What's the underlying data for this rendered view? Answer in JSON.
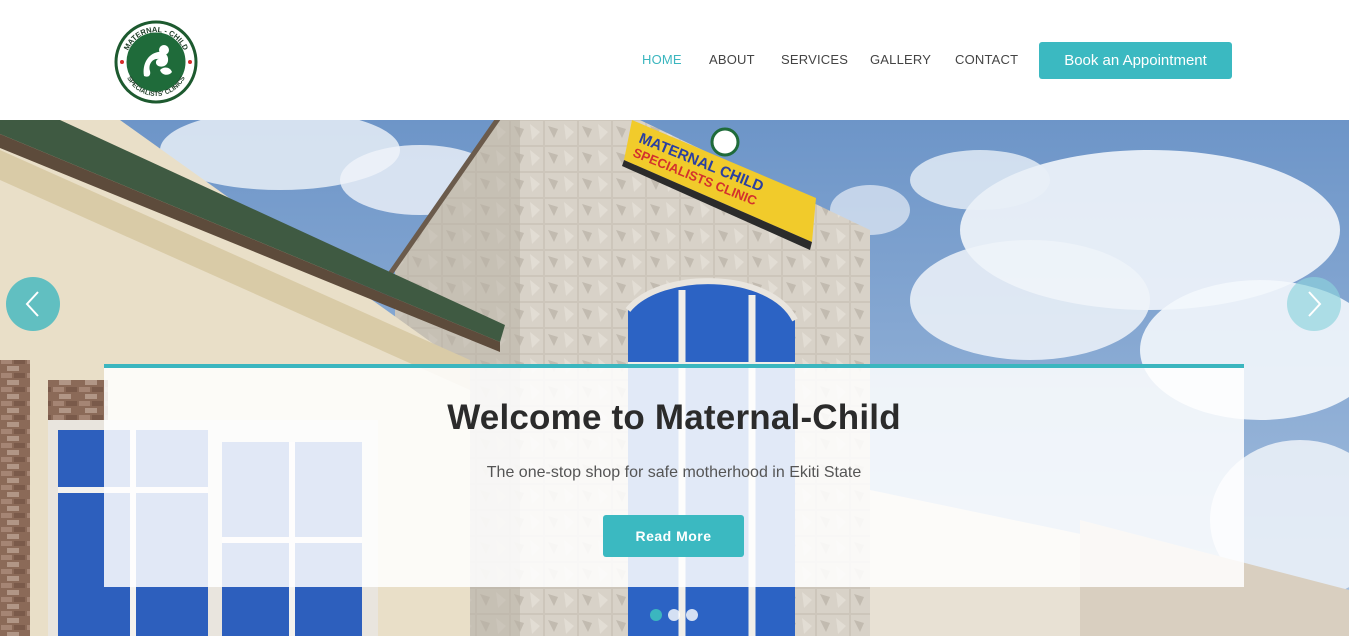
{
  "brand": {
    "logo_icon": "maternal-child-logo",
    "logo_text_top": "MATERNAL - CHILD",
    "logo_text_bottom": "SPECIALISTS' CLINICS"
  },
  "nav": {
    "items": [
      {
        "label": "HOME",
        "active": true
      },
      {
        "label": "ABOUT",
        "active": false
      },
      {
        "label": "SERVICES",
        "active": false
      },
      {
        "label": "GALLERY",
        "active": false
      },
      {
        "label": "CONTACT",
        "active": false
      }
    ],
    "cta_label": "Book an Appointment"
  },
  "hero": {
    "sign_line1": "MATERNAL CHILD",
    "sign_line2": "SPECIALISTS CLINIC",
    "title": "Welcome to Maternal-Child",
    "subtitle": "The one-stop shop for safe motherhood in Ekiti State",
    "button_label": "Read More",
    "prev_icon": "chevron-left-icon",
    "next_icon": "chevron-right-icon",
    "slide_count": 3,
    "active_slide": 1
  },
  "colors": {
    "accent": "#3bb6bf",
    "text_dark": "#2b2b2b",
    "nav_text": "#444444"
  }
}
